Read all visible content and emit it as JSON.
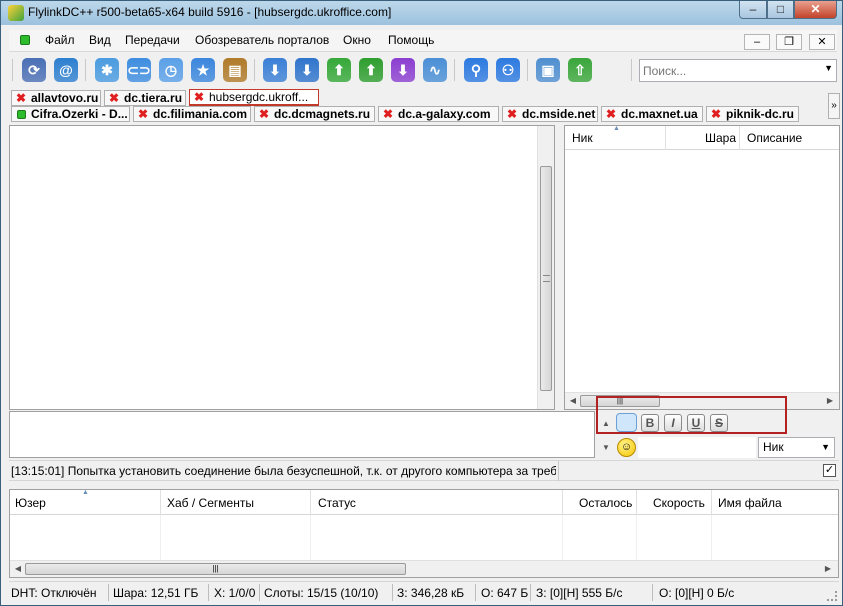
{
  "window": {
    "title": "FlylinkDC++ r500-beta65-x64 build 5916 - [hubsergdc.ukroffice.com]",
    "controls": {
      "minimize": "–",
      "maximize": "□",
      "close": "✕"
    }
  },
  "menu": {
    "items": [
      "Файл",
      "Вид",
      "Передачи",
      "Обозреватель порталов",
      "Окно",
      "Помощь"
    ],
    "mdi": {
      "minimize": "–",
      "restore": "❐",
      "close": "✕"
    }
  },
  "toolbar": {
    "buttons": [
      {
        "name": "reconnect-icon",
        "glyph": "⟳",
        "color": "#4a6fb5"
      },
      {
        "name": "spiral-icon",
        "glyph": "@",
        "color": "#2d7fd0"
      },
      {
        "name": "network-icon",
        "glyph": "✱",
        "color": "#4a9be0"
      },
      {
        "name": "link-icon",
        "glyph": "⊂⊃",
        "color": "#3e8de0"
      },
      {
        "name": "clock-icon",
        "glyph": "◷",
        "color": "#5aa0e8"
      },
      {
        "name": "favorite-star-icon",
        "glyph": "★",
        "color": "#3b86dd"
      },
      {
        "name": "address-book-icon",
        "glyph": "▤",
        "color": "#b07a2a"
      },
      {
        "name": "download-queue-icon",
        "glyph": "⬇",
        "color": "#3a7fd6"
      },
      {
        "name": "download-icon",
        "glyph": "⬇",
        "color": "#2f74cc"
      },
      {
        "name": "upload-queue-icon",
        "glyph": "⬆",
        "color": "#35a838"
      },
      {
        "name": "upload-icon",
        "glyph": "⬆",
        "color": "#2e9e2e"
      },
      {
        "name": "finished-downloads-icon",
        "glyph": "⬇",
        "color": "#8b3ed0"
      },
      {
        "name": "bandwidth-chart-icon",
        "glyph": "∿",
        "color": "#4a8fd6"
      },
      {
        "name": "search-icon",
        "glyph": "⚲",
        "color": "#2c7ae0"
      },
      {
        "name": "adl-search-icon",
        "glyph": "⚇",
        "color": "#2c7ae0"
      },
      {
        "name": "notepad-icon",
        "glyph": "▣",
        "color": "#4f8fd0"
      },
      {
        "name": "share-upload-icon",
        "glyph": "⇧",
        "color": "#3aa63a"
      }
    ],
    "search_placeholder": "Поиск..."
  },
  "tabs": {
    "row1": [
      {
        "label": "allavtovo.ru",
        "status": "error",
        "active": false
      },
      {
        "label": "dc.tiera.ru",
        "status": "error",
        "active": false
      },
      {
        "label": "hubsergdc.ukroff...",
        "status": "error",
        "active": true
      }
    ],
    "row2": [
      {
        "label": "Cifra.Ozerki - D...",
        "status": "online",
        "active": false
      },
      {
        "label": "dc.filimania.com",
        "status": "error",
        "active": false
      },
      {
        "label": "dc.dcmagnets.ru",
        "status": "error",
        "active": false
      },
      {
        "label": "dc.a-galaxy.com",
        "status": "error",
        "active": false
      },
      {
        "label": "dc.mside.net",
        "status": "error",
        "active": false
      },
      {
        "label": "dc.maxnet.ua",
        "status": "error",
        "active": false
      },
      {
        "label": "piknik-dc.ru",
        "status": "error",
        "active": false
      }
    ],
    "overflow": "»"
  },
  "user_list": {
    "columns": [
      "Ник",
      "Шара",
      "Описание"
    ]
  },
  "chat_input": {
    "format_buttons": [
      "B",
      "I",
      "U",
      "S"
    ],
    "nick_select": "Ник"
  },
  "status_message": "[13:15:01] Попытка установить соединение была безуспешной, т.к. от другого компьютера за треб",
  "status_checkbox": "✓",
  "queue": {
    "columns": [
      "Юзер",
      "Хаб / Сегменты",
      "Статус",
      "Осталось",
      "Скорость",
      "Имя файла"
    ]
  },
  "statusbar": {
    "dht": "DHT: Отключён",
    "share": "Шара: 12,51 ГБ",
    "hubs": "Х: 1/0/0",
    "slots": "Слоты: 15/15 (10/10)",
    "downloaded": "З: 346,28 кБ",
    "uploaded": "О: 647 Б",
    "download_speed": "З: [0][Н] 555 Б/с",
    "upload_speed": "О: [0][Н] 0 Б/с"
  }
}
